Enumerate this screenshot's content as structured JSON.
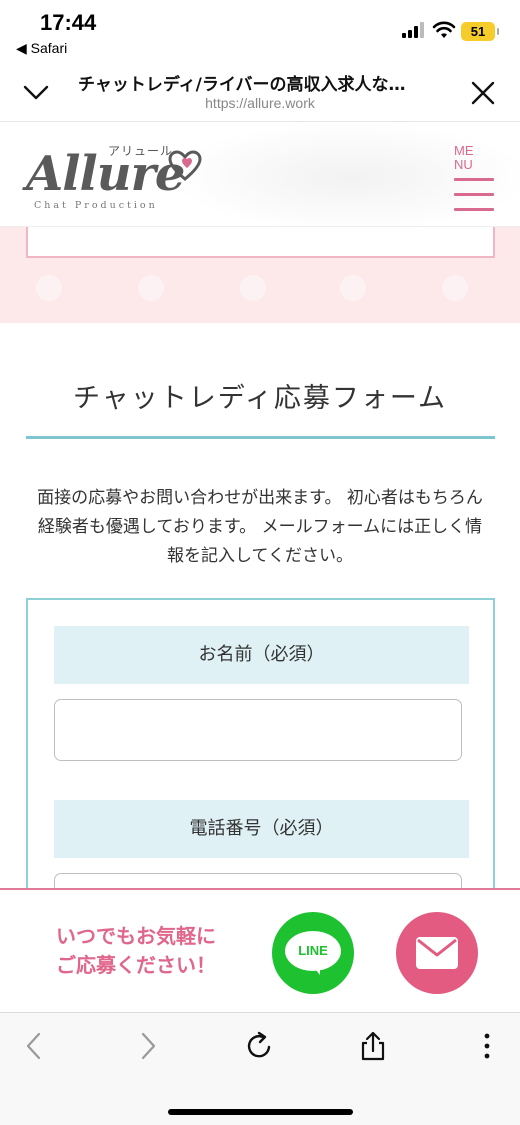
{
  "status_bar": {
    "time": "17:44",
    "back_app": "◀ Safari",
    "battery": "51"
  },
  "browser": {
    "page_title": "チャットレディ/ライバーの高収入求人な…",
    "url": "https://allure.work"
  },
  "site_header": {
    "logo_main": "Allure",
    "logo_kana": "アリュール",
    "logo_sub": "Chat Production",
    "menu_label_1": "ME",
    "menu_label_2": "NU"
  },
  "form_section": {
    "title": "チャットレディ応募フォーム",
    "intro": "面接の応募やお問い合わせが出来ます。 初心者はもちろん経験者も優遇しております。 メールフォームには正しく情報を記入してください。",
    "fields": [
      {
        "label": "お名前（必須）",
        "value": ""
      },
      {
        "label": "電話番号（必須）",
        "value": ""
      }
    ]
  },
  "cta": {
    "line_1": "いつでもお気軽に",
    "line_2": "ご応募ください！",
    "line_button_label": "LINE"
  },
  "colors": {
    "accent_pink": "#e0668c",
    "teal_rule": "#7ec6cf",
    "label_bg": "#dff1f4",
    "line_green": "#1ec12f",
    "mail_pink": "#e35b80",
    "band_pink": "#fde8ea"
  },
  "icons": {
    "chevron_down": "chevron-down-icon",
    "close": "close-icon",
    "signal": "signal-icon",
    "wifi": "wifi-icon",
    "back": "chevron-left-icon",
    "forward": "chevron-right-icon",
    "reload": "reload-icon",
    "share": "share-icon",
    "more": "more-vertical-icon",
    "mail": "mail-icon",
    "heart": "heart-icon"
  }
}
